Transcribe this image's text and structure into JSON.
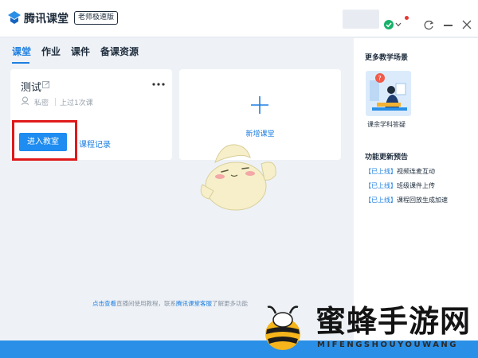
{
  "header": {
    "app_title": "腾讯课堂",
    "edition_badge": "老师极速版"
  },
  "tabs": [
    {
      "label": "课堂",
      "active": true
    },
    {
      "label": "作业",
      "active": false
    },
    {
      "label": "课件",
      "active": false
    },
    {
      "label": "备课资源",
      "active": false
    }
  ],
  "class_card": {
    "name": "测试",
    "privacy": "私密",
    "last_class": "上过1次课",
    "enter_button": "进入教室",
    "history_link": "课程记录"
  },
  "add_card": {
    "label": "新增课堂"
  },
  "help": {
    "part1": "点击查看",
    "part2": "直播间使用教程，联系",
    "part3": "腾讯课堂客服",
    "part4": "了解更多功能"
  },
  "sidebar": {
    "scenes_title": "更多教学场景",
    "scene_label": "课余学科答疑",
    "updates_title": "功能更新预告",
    "updates": [
      {
        "tag": "【已上线】",
        "text": "视频连麦互动"
      },
      {
        "tag": "【已上线】",
        "text": "班级课件上传"
      },
      {
        "tag": "【已上线】",
        "text": "课程回放生成加速"
      }
    ]
  },
  "watermark": {
    "title": "蜜蜂手游网",
    "subtitle": "MIFENGSHOUYOUWANG"
  },
  "colors": {
    "accent": "#1e7fe0",
    "button": "#1e8cf0",
    "highlight": "#e01a1a",
    "bottom_bar": "#2a8fe6"
  }
}
